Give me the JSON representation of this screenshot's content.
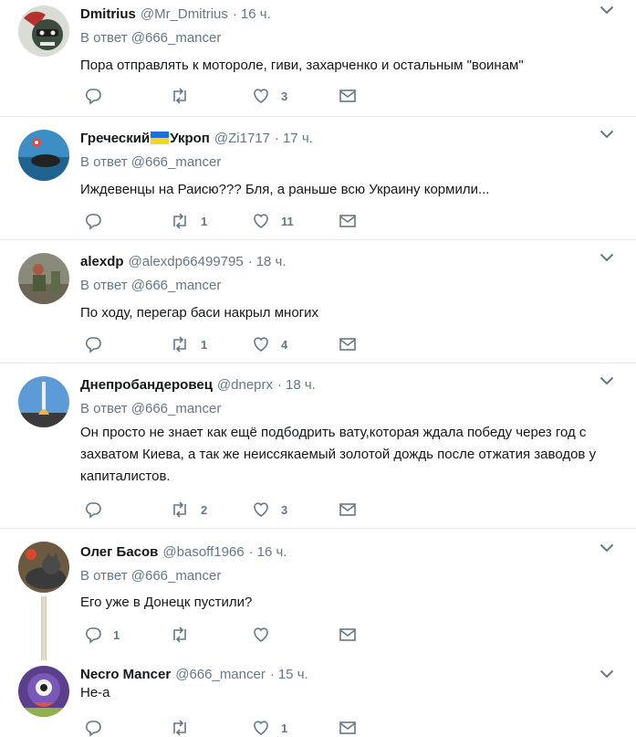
{
  "reply_prefix": "В ответ",
  "tweets": [
    {
      "name": "Dmitrius",
      "handle": "@Mr_Dmitrius",
      "time": "16 ч.",
      "reply_to": "@666_mancer",
      "text": "Пора отправлять к мотороле, гиви, захарченко и остальным \"воинам\"",
      "replies": "",
      "retweets": "",
      "likes": "3",
      "avatar_color": "#5a6a55"
    },
    {
      "name": "Греческий",
      "name_after_flag": "Укроп",
      "handle": "@Zi1717",
      "time": "17 ч.",
      "reply_to": "@666_mancer",
      "text": "Иждевенцы на Раисю??? Бля, а раньше всю Украину кормили...",
      "replies": "",
      "retweets": "1",
      "likes": "11",
      "avatar_color": "#2d83b0"
    },
    {
      "name": "alexdp",
      "handle": "@alexdp66499795",
      "time": "18 ч.",
      "reply_to": "@666_mancer",
      "text": "По ходу, перегар баси накрыл многих",
      "replies": "",
      "retweets": "1",
      "likes": "4",
      "avatar_color": "#6e6a55"
    },
    {
      "name": "Днепробандеровец",
      "handle": "@dneprx",
      "time": "18 ч.",
      "reply_to": "@666_mancer",
      "text": "Он просто не знает как ещё подбодрить вату,которая ждала победу через год с захватом Киева, а так же неиссякаемый золотой дождь после отжатия заводов у капиталистов.",
      "replies": "",
      "retweets": "2",
      "likes": "3",
      "avatar_color": "#4a86c5"
    },
    {
      "name": "Олег Басов",
      "handle": "@basoff1966",
      "time": "16 ч.",
      "reply_to": "@666_mancer",
      "text": "Его уже в Донецк пустили?",
      "replies": "1",
      "retweets": "",
      "likes": "",
      "avatar_color": "#4a4a4a"
    },
    {
      "name": "Necro Mancer",
      "handle": "@666_mancer",
      "time": "15 ч.",
      "reply_to": "",
      "text": "Не-а",
      "replies": "",
      "retweets": "",
      "likes": "1",
      "avatar_color": "#5b3e8c"
    }
  ],
  "colors": {
    "separator": "#e6ecf0",
    "secondary_text": "#657786",
    "primary_text": "#14171a"
  }
}
